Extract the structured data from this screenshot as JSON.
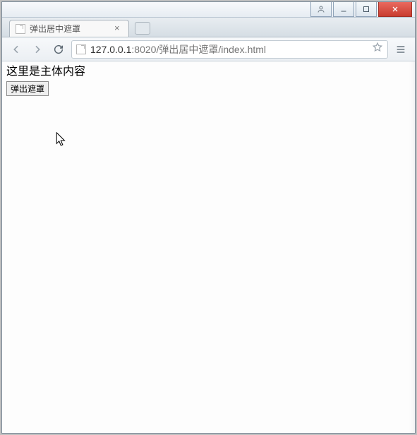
{
  "window": {
    "user_btn_title": "User",
    "minimize_title": "Minimize",
    "maximize_title": "Maximize",
    "close_title": "Close"
  },
  "tabs": {
    "active": {
      "title": "弹出居中遮罩",
      "close_title": "Close tab"
    },
    "newtab_title": "New tab"
  },
  "toolbar": {
    "back_title": "Back",
    "forward_title": "Forward",
    "reload_title": "Reload",
    "url_host": "127.0.0.1",
    "url_port": ":8020",
    "url_path": "/弹出居中遮罩/index.html",
    "bookmark_title": "Bookmark this page",
    "menu_title": "Customize and control"
  },
  "page": {
    "body_text": "这里是主体内容",
    "button_label": "弹出遮罩"
  }
}
